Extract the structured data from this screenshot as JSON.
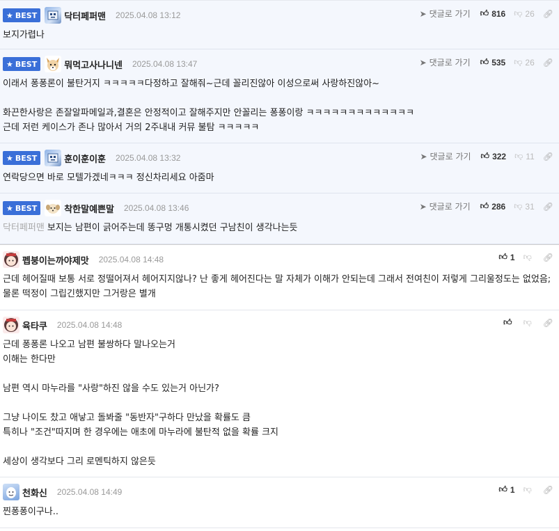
{
  "best_label": "BEST",
  "reply_label": "댓글로 가기",
  "comments": [
    {
      "best": true,
      "nick": "닥터페퍼맨",
      "date": "2025.04.08 13:12",
      "likes": "816",
      "dislikes": "26",
      "text": "보지가렵나"
    },
    {
      "best": true,
      "nick": "뭐먹고사나니넨",
      "date": "2025.04.08 13:47",
      "likes": "535",
      "dislikes": "26",
      "text": "이래서 퐁퐁론이 불탄거지 ㅋㅋㅋㅋㅋ다정하고 잘해줘~근데 꼴리진않아 이성으로써 사랑하진않아~\n\n화끈한사랑은 존잘알파메일과,결혼은 안정적이고 잘해주지만 안꼴리는 퐁퐁이랑 ㅋㅋㅋㅋㅋㅋㅋㅋㅋㅋㅋㅋㅋ\n근데 저런 케이스가 존나 많아서 거의 2주내내 커뮤 불탐 ㅋㅋㅋㅋㅋ"
    },
    {
      "best": true,
      "nick": "훈이훈이훈",
      "date": "2025.04.08 13:32",
      "likes": "322",
      "dislikes": "11",
      "text": "연락당으면 바로 모텔가겠네ㅋㅋㅋ 정신차리세요 아줌마"
    },
    {
      "best": true,
      "nick": "착한말예쁜말",
      "date": "2025.04.08 13:46",
      "likes": "286",
      "dislikes": "31",
      "quote": "닥터페퍼맨",
      "text": "보지는 남편이 긁어주는데 똥구멍 개통시켰던 구남친이 생각나는듯"
    },
    {
      "best": false,
      "nick": "펩붕이는까야제맛",
      "date": "2025.04.08 14:48",
      "likes": "1",
      "dislikes": "",
      "text": "근데 헤어질때 보통 서로 정떨어져서 헤어지지않나? 난 좋게 헤어진다는 말 자체가 이해가 안되는데 그래서 전여친이 저렇게 그리울정도는 없었음; 물론 떡정이 그립긴했지만 그거랑은 별개"
    },
    {
      "best": false,
      "nick": "육타쿠",
      "date": "2025.04.08 14:48",
      "likes": "",
      "dislikes": "",
      "text": "근데 퐁퐁론 나오고 남편 불쌍하다 말나오는거\n이해는 한다만\n\n남편 역시 마누라를 \"사랑\"하진 않을 수도 있는거 아닌가?\n\n그냥 나이도 찼고 애낳고 돌봐줄 \"동반자\"구하다 만났을 확률도 큼\n특히나 \"조건\"따지며 한 경우에는 애초에 마누라에 불탄적 없을 확률 크지\n\n세상이 생각보다 그리 로멘틱하지 않은듯"
    },
    {
      "best": false,
      "nick": "천화신",
      "date": "2025.04.08 14:49",
      "likes": "1",
      "dislikes": "",
      "text": "찐퐁퐁이구나.."
    }
  ]
}
